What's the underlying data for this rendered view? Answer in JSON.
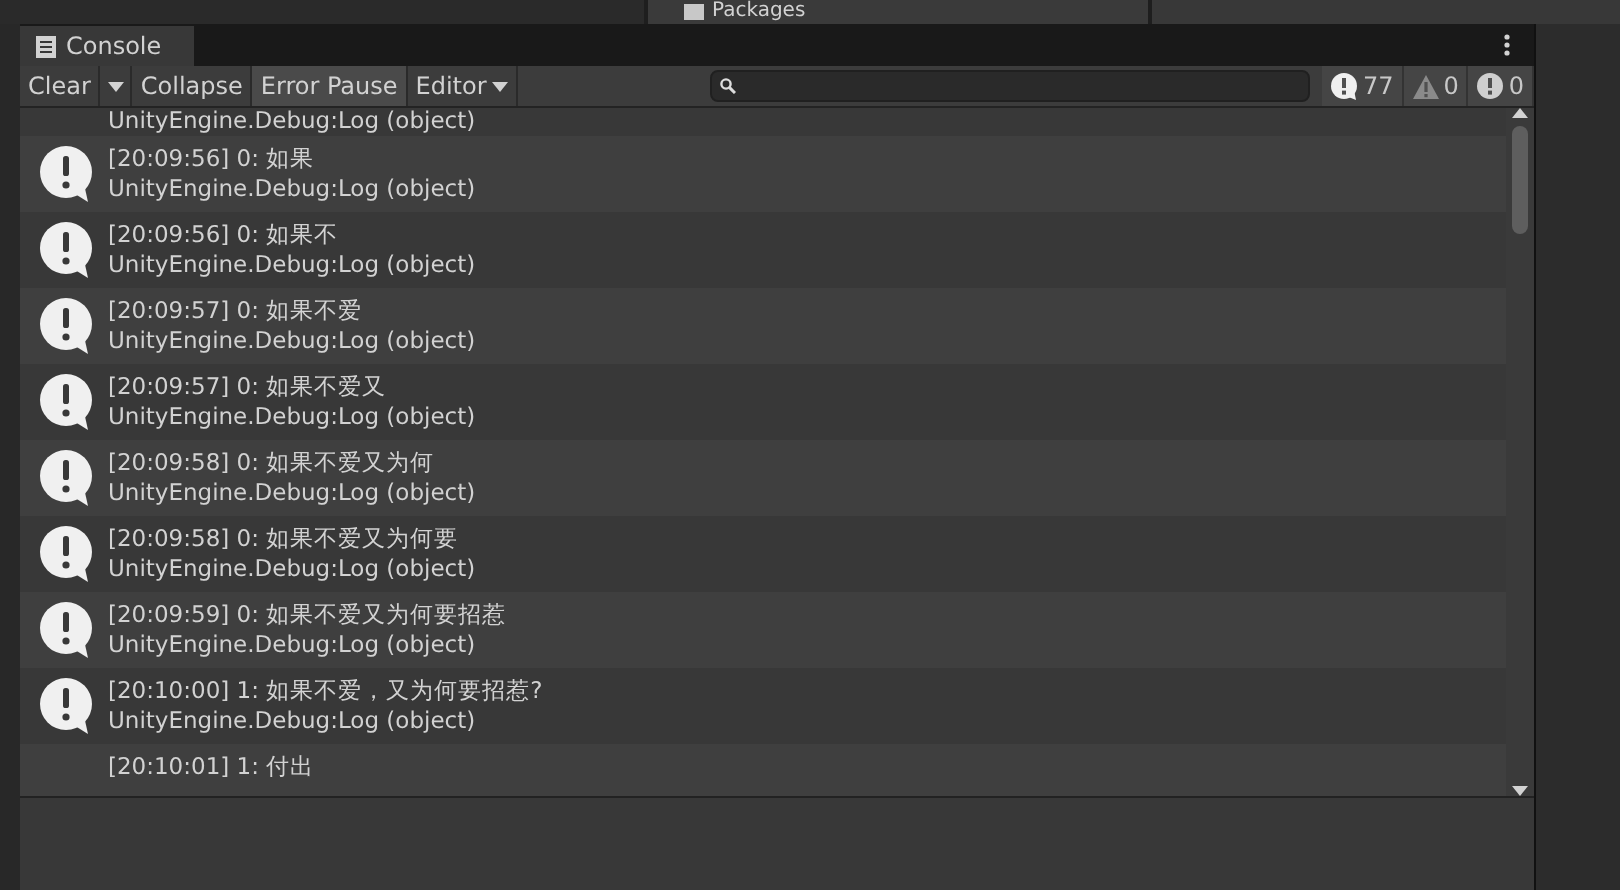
{
  "top_strip": {
    "folder_label": "Packages"
  },
  "window": {
    "title": "Console"
  },
  "toolbar": {
    "clear": "Clear",
    "toggles": [
      {
        "label": "Collapse",
        "on": false
      },
      {
        "label": "Error Pause",
        "on": true
      }
    ],
    "editor": "Editor",
    "counters": [
      {
        "kind": "info",
        "count": "77"
      },
      {
        "kind": "warning",
        "count": "0"
      },
      {
        "kind": "error",
        "count": "0"
      }
    ]
  },
  "log": [
    {
      "kind": "tail",
      "detail": "UnityEngine.Debug:Log (object)"
    },
    {
      "kind": "full",
      "message": "[20:09:56] 0: 如果",
      "detail": "UnityEngine.Debug:Log (object)"
    },
    {
      "kind": "full",
      "message": "[20:09:56] 0: 如果不",
      "detail": "UnityEngine.Debug:Log (object)"
    },
    {
      "kind": "full",
      "message": "[20:09:57] 0: 如果不爱",
      "detail": "UnityEngine.Debug:Log (object)"
    },
    {
      "kind": "full",
      "message": "[20:09:57] 0: 如果不爱又",
      "detail": "UnityEngine.Debug:Log (object)"
    },
    {
      "kind": "full",
      "message": "[20:09:58] 0: 如果不爱又为何",
      "detail": "UnityEngine.Debug:Log (object)"
    },
    {
      "kind": "full",
      "message": "[20:09:58] 0: 如果不爱又为何要",
      "detail": "UnityEngine.Debug:Log (object)"
    },
    {
      "kind": "full",
      "message": "[20:09:59] 0: 如果不爱又为何要招惹",
      "detail": "UnityEngine.Debug:Log (object)"
    },
    {
      "kind": "full",
      "message": "[20:10:00] 1: 如果不爱，又为何要招惹?",
      "detail": "UnityEngine.Debug:Log (object)"
    },
    {
      "kind": "head",
      "message": "[20:10:01] 1: 付出"
    }
  ]
}
